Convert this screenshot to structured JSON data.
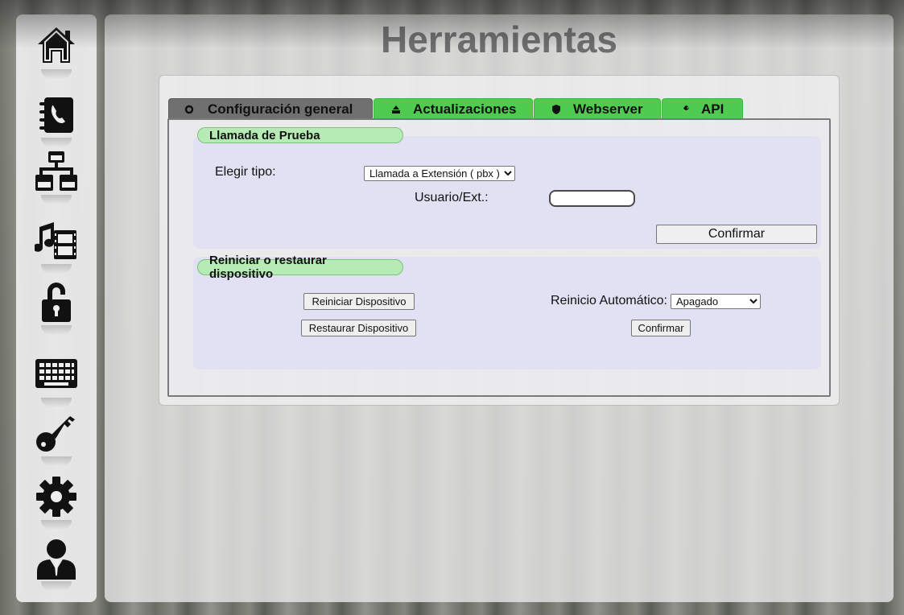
{
  "sidebar": {
    "items": [
      {
        "icon": "home-icon"
      },
      {
        "icon": "phonebook-icon"
      },
      {
        "icon": "network-icon"
      },
      {
        "icon": "media-icon"
      },
      {
        "icon": "lock-icon"
      },
      {
        "icon": "keyboard-icon"
      },
      {
        "icon": "key-icon"
      },
      {
        "icon": "gear-icon"
      },
      {
        "icon": "user-icon"
      }
    ]
  },
  "page": {
    "title": "Herramientas"
  },
  "tabs": [
    {
      "label": "Configuración general",
      "icon": "circle-icon",
      "active": true
    },
    {
      "label": "Actualizaciones",
      "icon": "update-icon",
      "active": false
    },
    {
      "label": "Webserver",
      "icon": "shield-icon",
      "active": false
    },
    {
      "label": "API",
      "icon": "wrench-icon",
      "active": false
    }
  ],
  "test_call": {
    "title": "Llamada de Prueba",
    "type_label": "Elegir tipo:",
    "type_selected": "Llamada a Extensión ( pbx )",
    "user_label": "Usuario/Ext.:",
    "user_value": "",
    "confirm_label": "Confirmar"
  },
  "restart": {
    "title": "Reiniciar o restaurar dispositivo",
    "restart_button": "Reiniciar Dispositivo",
    "restore_button": "Restaurar Dispositivo",
    "auto_label": "Reinicio Automático:",
    "auto_selected": "Apagado",
    "confirm_label": "Confirmar"
  },
  "colors": {
    "tab_active": "#707070",
    "tab_inactive": "#4fcc4f",
    "section_title_bg": "#b6ebb6",
    "title_text": "#6e6e6e"
  }
}
